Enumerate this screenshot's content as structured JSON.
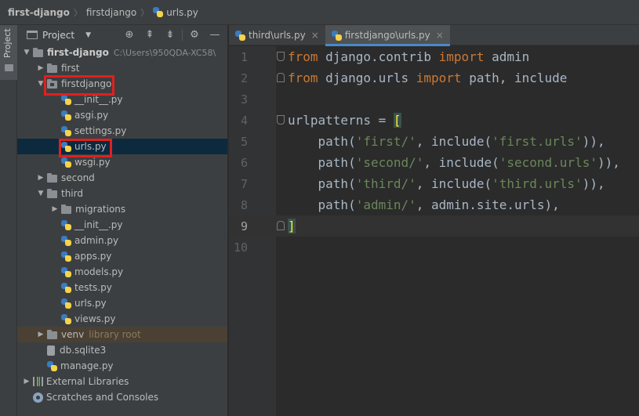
{
  "breadcrumb": {
    "project": "first-django",
    "folder": "firstdjango",
    "file": "urls.py"
  },
  "sidebar_strip": {
    "label": "Project"
  },
  "project_panel": {
    "title": "Project",
    "tools": [
      "target-icon",
      "collapse-icon",
      "expand-icon",
      "gear-icon",
      "minimize-icon"
    ],
    "tree": [
      {
        "label": "first-django",
        "hint": "C:\\Users\\950QDA-XC58\\",
        "type": "folder",
        "expanded": true,
        "indent": 0
      },
      {
        "label": "first",
        "type": "folder",
        "expanded": false,
        "indent": 1
      },
      {
        "label": "firstdjango",
        "type": "module",
        "expanded": true,
        "indent": 1,
        "highlighted": true
      },
      {
        "label": "__init__.py",
        "type": "py",
        "indent": 2
      },
      {
        "label": "asgi.py",
        "type": "py",
        "indent": 2
      },
      {
        "label": "settings.py",
        "type": "py",
        "indent": 2
      },
      {
        "label": "urls.py",
        "type": "py",
        "indent": 2,
        "selected": true,
        "highlighted": true
      },
      {
        "label": "wsgi.py",
        "type": "py",
        "indent": 2
      },
      {
        "label": "second",
        "type": "folder",
        "expanded": false,
        "indent": 1
      },
      {
        "label": "third",
        "type": "folder",
        "expanded": true,
        "indent": 1
      },
      {
        "label": "migrations",
        "type": "folder",
        "expanded": false,
        "indent": 2
      },
      {
        "label": "__init__.py",
        "type": "py",
        "indent": 2
      },
      {
        "label": "admin.py",
        "type": "py",
        "indent": 2
      },
      {
        "label": "apps.py",
        "type": "py",
        "indent": 2
      },
      {
        "label": "models.py",
        "type": "py",
        "indent": 2
      },
      {
        "label": "tests.py",
        "type": "py",
        "indent": 2
      },
      {
        "label": "urls.py",
        "type": "py",
        "indent": 2
      },
      {
        "label": "views.py",
        "type": "py",
        "indent": 2
      },
      {
        "label": "venv",
        "hint": "library root",
        "type": "folder",
        "expanded": false,
        "indent": 1,
        "venv": true
      },
      {
        "label": "db.sqlite3",
        "type": "db",
        "indent": 1
      },
      {
        "label": "manage.py",
        "type": "py",
        "indent": 1
      },
      {
        "label": "External Libraries",
        "type": "lib",
        "expanded": false,
        "indent": 0
      },
      {
        "label": "Scratches and Consoles",
        "type": "scratch",
        "indent": 0
      }
    ]
  },
  "tabs": [
    {
      "label": "third\\urls.py",
      "active": false
    },
    {
      "label": "firstdjango\\urls.py",
      "active": true
    }
  ],
  "editor": {
    "current_line": 9,
    "lines": [
      {
        "n": "1",
        "tokens": [
          [
            "kw",
            "from"
          ],
          [
            "t",
            " django.contrib "
          ],
          [
            "kw",
            "import"
          ],
          [
            "t",
            " admin"
          ]
        ]
      },
      {
        "n": "2",
        "tokens": [
          [
            "kw",
            "from"
          ],
          [
            "t",
            " django.urls "
          ],
          [
            "kw",
            "import"
          ],
          [
            "t",
            " path, include"
          ]
        ]
      },
      {
        "n": "3",
        "tokens": []
      },
      {
        "n": "4",
        "tokens": [
          [
            "t",
            "urlpatterns = "
          ],
          [
            "b",
            "["
          ]
        ]
      },
      {
        "n": "5",
        "tokens": [
          [
            "t",
            "    path("
          ],
          [
            "str",
            "'first/'"
          ],
          [
            "t",
            ", include("
          ],
          [
            "str",
            "'first.urls'"
          ],
          [
            "t",
            ")),"
          ]
        ]
      },
      {
        "n": "6",
        "tokens": [
          [
            "t",
            "    path("
          ],
          [
            "str",
            "'second/'"
          ],
          [
            "t",
            ", include("
          ],
          [
            "str",
            "'second.urls'"
          ],
          [
            "t",
            ")),"
          ]
        ]
      },
      {
        "n": "7",
        "tokens": [
          [
            "t",
            "    path("
          ],
          [
            "str",
            "'third/'"
          ],
          [
            "t",
            ", include("
          ],
          [
            "str",
            "'third.urls'"
          ],
          [
            "t",
            ")),"
          ]
        ]
      },
      {
        "n": "8",
        "tokens": [
          [
            "t",
            "    path("
          ],
          [
            "str",
            "'admin/'"
          ],
          [
            "t",
            ", admin.site.urls),"
          ]
        ]
      },
      {
        "n": "9",
        "tokens": [
          [
            "b",
            "]"
          ]
        ]
      },
      {
        "n": "10",
        "tokens": []
      }
    ]
  },
  "colors": {
    "keyword": "#cc7832",
    "string": "#6a8759",
    "default": "#a9b7c6",
    "highlight_box": "#e0201f",
    "selection": "#0d293e"
  }
}
